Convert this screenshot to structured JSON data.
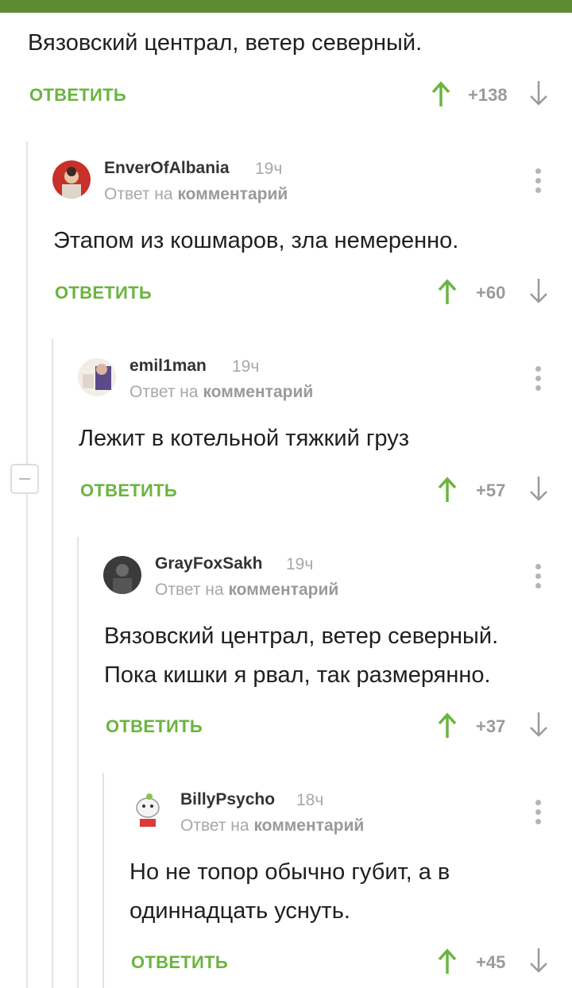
{
  "colors": {
    "accent": "#6bb43f",
    "statusbar": "#5d8a33",
    "muted": "#a8a8a8"
  },
  "top_comment": {
    "text": "Вязовский централ, ветер северный.",
    "reply_label": "ОТВЕТИТЬ",
    "score": "+138"
  },
  "comments": [
    {
      "author": "EnverOfAlbania",
      "time": "19ч",
      "reply_prefix": "Ответ на",
      "reply_target": "комментарий",
      "text": "Этапом из кошмаров, зла немеренно.",
      "reply_label": "ОТВЕТИТЬ",
      "score": "+60"
    },
    {
      "author": "emil1man",
      "time": "19ч",
      "reply_prefix": "Ответ на",
      "reply_target": "комментарий",
      "text": "Лежит в котельной тяжкий груз",
      "reply_label": "ОТВЕТИТЬ",
      "score": "+57"
    },
    {
      "author": "GrayFoxSakh",
      "time": "19ч",
      "reply_prefix": "Ответ на",
      "reply_target": "комментарий",
      "text_lines": [
        "Вязовский централ, ветер северный.",
        "Пока кишки я рвал, так размерянно."
      ],
      "reply_label": "ОТВЕТИТЬ",
      "score": "+37"
    },
    {
      "author": "BillyPsycho",
      "time": "18ч",
      "reply_prefix": "Ответ на",
      "reply_target": "комментарий",
      "text_lines": [
        "Но не топор обычно губит, а в",
        "одиннадцать уснуть."
      ],
      "reply_label": "ОТВЕТИТЬ",
      "score": "+45"
    }
  ],
  "icons": [
    "upvote-arrow-icon",
    "downvote-arrow-icon",
    "more-options-icon",
    "collapse-thread-icon",
    "avatar"
  ]
}
